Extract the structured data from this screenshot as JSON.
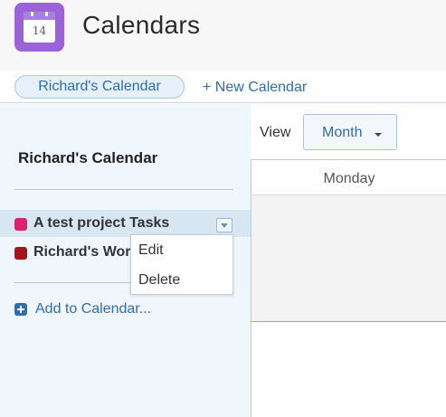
{
  "app": {
    "title": "Calendars",
    "icon": {
      "name": "calendar-icon",
      "day_number": "14",
      "color": "#9b63d8"
    }
  },
  "tabs": {
    "active_label": "Richard's Calendar",
    "new_calendar_label": "+ New Calendar"
  },
  "sidebar": {
    "title": "Richard's Calendar",
    "calendars": [
      {
        "label": "A test project Tasks",
        "color": "#d7246c",
        "selected": true
      },
      {
        "label": "Richard's Wor",
        "color": "#9e1a1a",
        "selected": false
      }
    ],
    "context_menu": {
      "items": [
        "Edit",
        "Delete"
      ]
    },
    "add_label": "Add to Calendar..."
  },
  "calendar_view": {
    "view_label": "View",
    "view_mode": "Month",
    "day_header": "Monday"
  },
  "colors": {
    "accent": "#2f6db0",
    "sidebar_bg": "#eff6fc",
    "selected_row_bg": "#d7e6f3"
  }
}
